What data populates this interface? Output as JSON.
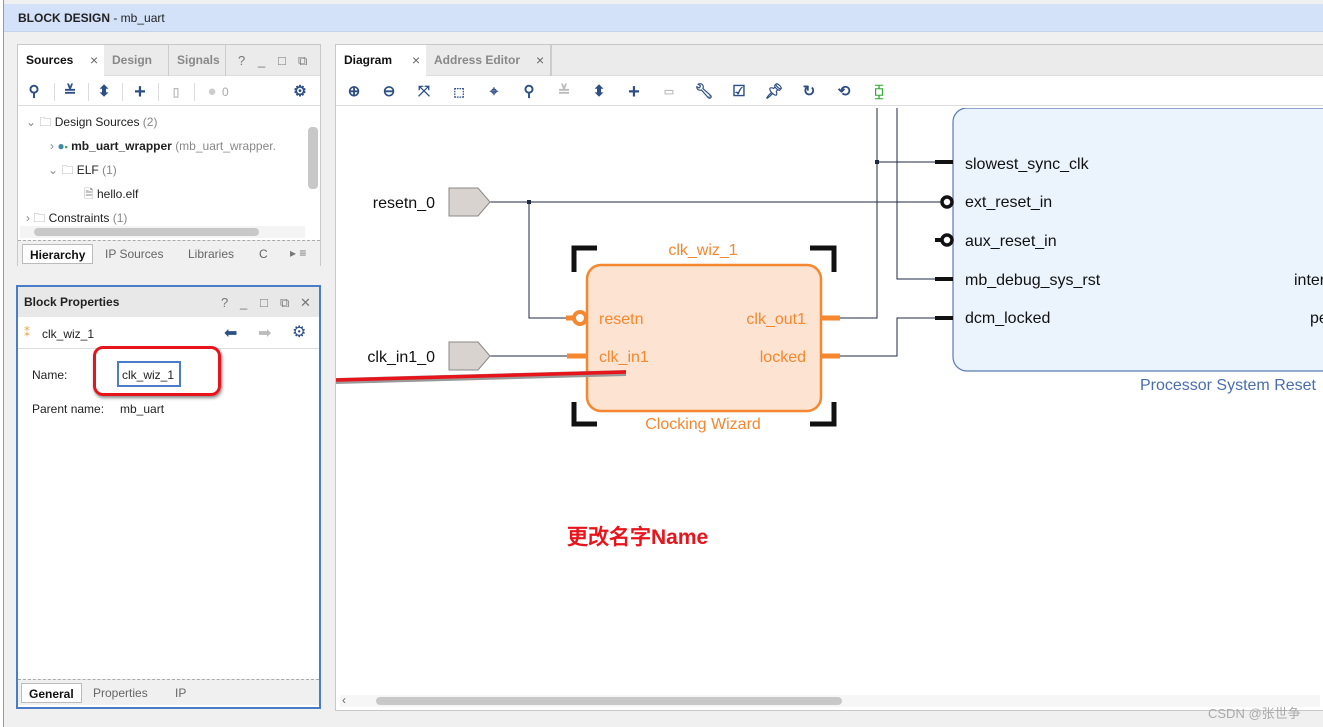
{
  "window": {
    "title_bold": "BLOCK DESIGN",
    "title_rest": " - mb_uart"
  },
  "sources": {
    "tabs": [
      "Sources",
      "Design",
      "Signals"
    ],
    "issue_count": "0",
    "tree": [
      {
        "label": "Design Sources",
        "count": "(2)"
      },
      {
        "label": "mb_uart_wrapper",
        "extra": "(mb_uart_wrapper."
      },
      {
        "label": "ELF",
        "count": "(1)"
      },
      {
        "label": "hello.elf"
      },
      {
        "label": "Constraints",
        "count": "(1)"
      }
    ],
    "bottom_tabs": [
      "Hierarchy",
      "IP Sources",
      "Libraries",
      "C"
    ]
  },
  "block_properties": {
    "title": "Block Properties",
    "selected": "clk_wiz_1",
    "name_label": "Name:",
    "name_value": "clk_wiz_1",
    "parent_label": "Parent name:",
    "parent_value": "mb_uart",
    "bottom_tabs": [
      "General",
      "Properties",
      "IP"
    ]
  },
  "diagram": {
    "tabs": [
      "Diagram",
      "Address Editor"
    ],
    "ports": {
      "resetn": "resetn_0",
      "clk": "clk_in1_0"
    },
    "clk_wiz": {
      "instance": "clk_wiz_1",
      "type": "Clocking Wizard",
      "pins_in": [
        "resetn",
        "clk_in1"
      ],
      "pins_out": [
        "clk_out1",
        "locked"
      ]
    },
    "proc_reset": {
      "type": "Processor System Reset",
      "pins_in": [
        "slowest_sync_clk",
        "ext_reset_in",
        "aux_reset_in",
        "mb_debug_sys_rst",
        "dcm_locked"
      ],
      "pins_out_partial": [
        "inter",
        "pe"
      ]
    }
  },
  "annotation": {
    "text": "更改名字Name",
    "color": "#e8141b"
  },
  "watermark": "CSDN @张世争",
  "colors": {
    "accent": "#4a7cc9",
    "block_orange": "#f5872e",
    "block_blue": "#5a7ab5"
  }
}
